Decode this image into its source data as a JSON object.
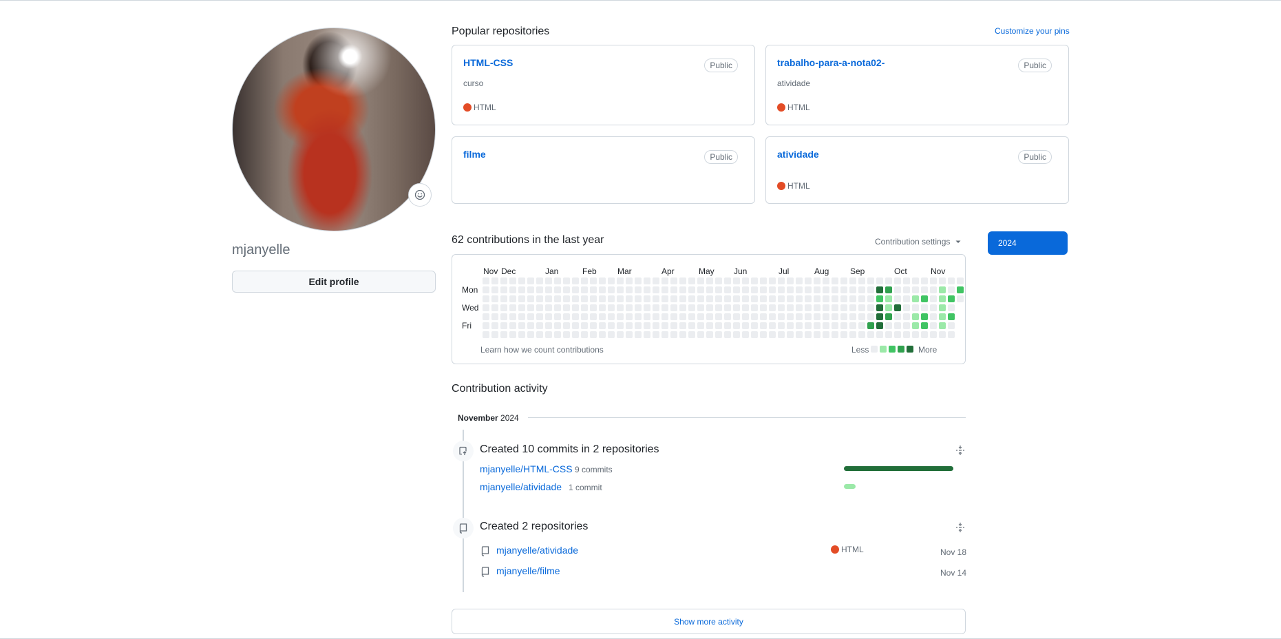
{
  "profile": {
    "username": "mjanyelle",
    "edit_label": "Edit profile"
  },
  "pinned": {
    "title": "Popular repositories",
    "customize_label": "Customize your pins",
    "repos": [
      {
        "name": "HTML-CSS",
        "visibility": "Public",
        "description": "curso",
        "language": "HTML"
      },
      {
        "name": "trabalho-para-a-nota02-",
        "visibility": "Public",
        "description": "atividade",
        "language": "HTML"
      },
      {
        "name": "filme",
        "visibility": "Public",
        "description": "",
        "language": ""
      },
      {
        "name": "atividade",
        "visibility": "Public",
        "description": "",
        "language": "HTML"
      }
    ]
  },
  "contributions": {
    "summary": "62 contributions in the last year",
    "settings_label": "Contribution settings",
    "year": "2024",
    "months": [
      "Nov",
      "Dec",
      "Jan",
      "Feb",
      "Mar",
      "Apr",
      "May",
      "Jun",
      "Jul",
      "Aug",
      "Sep",
      "Oct",
      "Nov"
    ],
    "day_labels": [
      "Mon",
      "Wed",
      "Fri"
    ],
    "learn_label": "Learn how we count contributions",
    "less_label": "Less",
    "more_label": "More",
    "colors": [
      "#ebedf0",
      "#9be9a8",
      "#40c463",
      "#30a14e",
      "#216e39"
    ],
    "active_weeks": [
      {
        "week": 43,
        "levels": [
          0,
          0,
          0,
          0,
          0,
          3,
          0
        ]
      },
      {
        "week": 44,
        "levels": [
          0,
          4,
          2,
          4,
          4,
          4,
          0
        ]
      },
      {
        "week": 45,
        "levels": [
          0,
          3,
          1,
          1,
          3,
          0,
          0
        ]
      },
      {
        "week": 46,
        "levels": [
          0,
          0,
          0,
          4,
          0,
          0,
          0
        ]
      },
      {
        "week": 48,
        "levels": [
          0,
          0,
          1,
          0,
          1,
          1,
          0
        ]
      },
      {
        "week": 49,
        "levels": [
          0,
          0,
          2,
          0,
          2,
          2,
          0
        ]
      },
      {
        "week": 51,
        "levels": [
          0,
          1,
          1,
          1,
          1,
          1,
          0
        ]
      },
      {
        "week": 52,
        "levels": [
          0,
          0,
          2,
          0,
          2,
          0,
          0
        ]
      },
      {
        "week": 53,
        "levels": [
          0,
          2,
          0,
          0,
          0,
          0,
          0
        ]
      }
    ]
  },
  "activity": {
    "title": "Contribution activity",
    "month": "November",
    "year": "2024",
    "commits": {
      "title": "Created 10 commits in 2 repositories",
      "items": [
        {
          "repo": "mjanyelle/HTML-CSS",
          "count": "9 commits",
          "share": 1.0,
          "color": "#216e39"
        },
        {
          "repo": "mjanyelle/atividade",
          "count": "1 commit",
          "share": 0.11,
          "color": "#9be9a8"
        }
      ]
    },
    "created": {
      "title": "Created 2 repositories",
      "items": [
        {
          "repo": "mjanyelle/atividade",
          "language": "HTML",
          "date": "Nov 18"
        },
        {
          "repo": "mjanyelle/filme",
          "language": "",
          "date": "Nov 14"
        }
      ]
    },
    "show_more": "Show more activity"
  }
}
